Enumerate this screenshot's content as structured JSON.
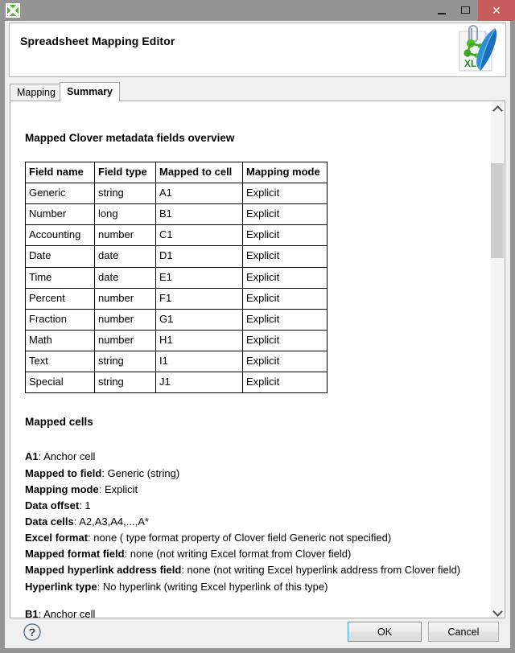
{
  "window": {
    "app_icon": "spreadsheet-icon",
    "controls": {
      "minimize": "–",
      "maximize": "□",
      "close": "✕"
    }
  },
  "header": {
    "title": "Spreadsheet Mapping Editor",
    "logo": "xls-clover-feather-logo",
    "logo_label": "XLS"
  },
  "tabs": [
    {
      "label": "Mapping",
      "selected": false
    },
    {
      "label": "Summary",
      "selected": true
    }
  ],
  "content": {
    "overview_title": "Mapped Clover metadata fields overview",
    "table": {
      "headers": [
        "Field name",
        "Field type",
        "Mapped to cell",
        "Mapping mode"
      ],
      "rows": [
        [
          "Generic",
          "string",
          "A1",
          "Explicit"
        ],
        [
          "Number",
          "long",
          "B1",
          "Explicit"
        ],
        [
          "Accounting",
          "number",
          "C1",
          "Explicit"
        ],
        [
          "Date",
          "date",
          "D1",
          "Explicit"
        ],
        [
          "Time",
          "date",
          "E1",
          "Explicit"
        ],
        [
          "Percent",
          "number",
          "F1",
          "Explicit"
        ],
        [
          "Fraction",
          "number",
          "G1",
          "Explicit"
        ],
        [
          "Math",
          "number",
          "H1",
          "Explicit"
        ],
        [
          "Text",
          "string",
          "I1",
          "Explicit"
        ],
        [
          "Special",
          "string",
          "J1",
          "Explicit"
        ]
      ]
    },
    "mapped_cells_title": "Mapped cells",
    "cells": [
      {
        "name": "A1",
        "kind": "Anchor cell",
        "props": [
          {
            "label": "Mapped to field",
            "value": "Generic (string)"
          },
          {
            "label": "Mapping mode",
            "value": "Explicit"
          },
          {
            "label": "Data offset",
            "value": "1"
          },
          {
            "label": "Data cells",
            "value": "A2,A3,A4,...,A*"
          },
          {
            "label": "Excel format",
            "value": "none ( type format property of Clover field Generic not specified)"
          },
          {
            "label": "Mapped format field",
            "value": "none (not writing Excel format from Clover field)"
          },
          {
            "label": "Mapped hyperlink address field",
            "value": "none (not writing Excel hyperlink address from Clover field)"
          },
          {
            "label": "Hyperlink type",
            "value": "No hyperlink (writing Excel hyperlink of this type)"
          }
        ]
      },
      {
        "name": "B1",
        "kind": "Anchor cell",
        "props": []
      }
    ]
  },
  "scrollbar": {
    "up_arrow": "chevron-up-icon",
    "down_arrow": "chevron-down-icon"
  },
  "footer": {
    "help": "?",
    "ok_label": "OK",
    "cancel_label": "Cancel"
  },
  "colors": {
    "titlebar": "#949494",
    "close_button": "#c75c5c",
    "dialog_bg": "#f0f0f0",
    "content_bg": "#ffffff",
    "focus_border": "#3c9ddf",
    "scroll_thumb": "#cdcdcd"
  }
}
